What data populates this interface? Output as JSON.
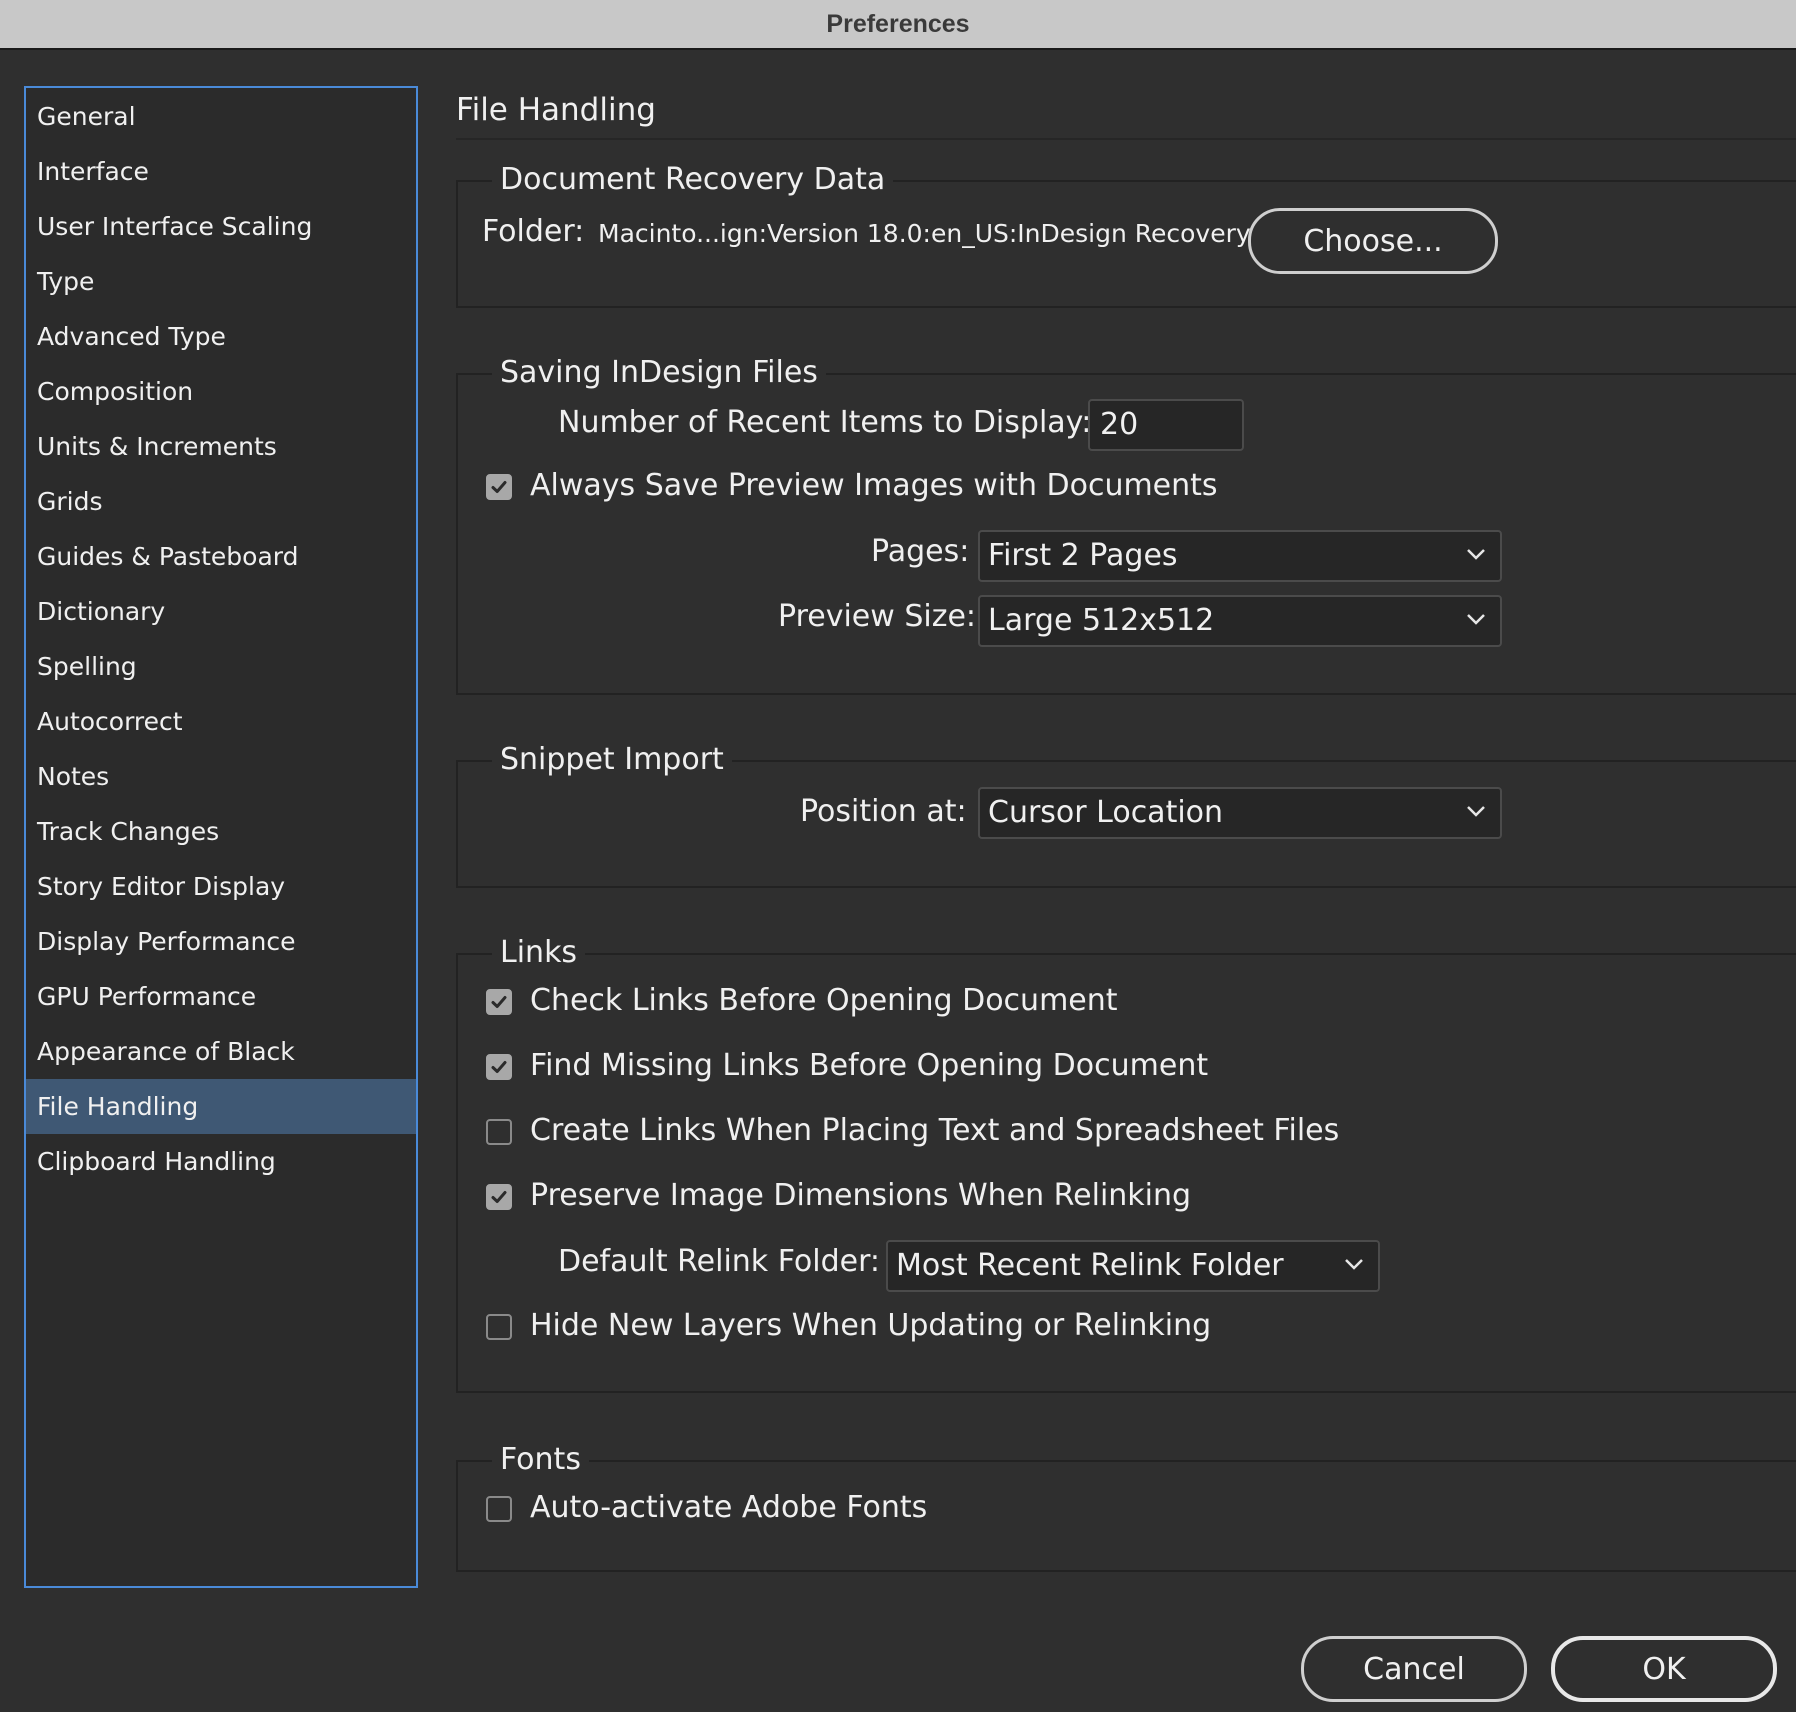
{
  "window": {
    "title": "Preferences"
  },
  "sidebar": {
    "items": [
      {
        "label": "General",
        "selected": false
      },
      {
        "label": "Interface",
        "selected": false
      },
      {
        "label": "User Interface Scaling",
        "selected": false
      },
      {
        "label": "Type",
        "selected": false
      },
      {
        "label": "Advanced Type",
        "selected": false
      },
      {
        "label": "Composition",
        "selected": false
      },
      {
        "label": "Units & Increments",
        "selected": false
      },
      {
        "label": "Grids",
        "selected": false
      },
      {
        "label": "Guides & Pasteboard",
        "selected": false
      },
      {
        "label": "Dictionary",
        "selected": false
      },
      {
        "label": "Spelling",
        "selected": false
      },
      {
        "label": "Autocorrect",
        "selected": false
      },
      {
        "label": "Notes",
        "selected": false
      },
      {
        "label": "Track Changes",
        "selected": false
      },
      {
        "label": "Story Editor Display",
        "selected": false
      },
      {
        "label": "Display Performance",
        "selected": false
      },
      {
        "label": "GPU Performance",
        "selected": false
      },
      {
        "label": "Appearance of Black",
        "selected": false
      },
      {
        "label": "File Handling",
        "selected": true
      },
      {
        "label": "Clipboard Handling",
        "selected": false
      }
    ]
  },
  "main": {
    "title": "File Handling",
    "recovery": {
      "title": "Document Recovery Data",
      "folder_label": "Folder:",
      "folder_path": "Macinto...ign:Version 18.0:en_US:InDesign Recovery",
      "choose_label": "Choose..."
    },
    "saving": {
      "title": "Saving InDesign Files",
      "recent_label": "Number of Recent Items to Display:",
      "recent_value": "20",
      "always_save_label": "Always Save Preview Images with Documents",
      "always_save_checked": true,
      "pages_label": "Pages:",
      "pages_value": "First 2 Pages",
      "preview_size_label": "Preview Size:",
      "preview_size_value": "Large 512x512"
    },
    "snippet": {
      "title": "Snippet Import",
      "position_label": "Position at:",
      "position_value": "Cursor Location"
    },
    "links": {
      "title": "Links",
      "check_links_label": "Check Links Before Opening Document",
      "check_links_checked": true,
      "find_missing_label": "Find Missing Links Before Opening Document",
      "find_missing_checked": true,
      "create_links_label": "Create Links When Placing Text and Spreadsheet Files",
      "create_links_checked": false,
      "preserve_label": "Preserve Image Dimensions When Relinking",
      "preserve_checked": true,
      "relink_folder_label": "Default Relink Folder:",
      "relink_folder_value": "Most Recent Relink Folder",
      "hide_layers_label": "Hide New Layers When Updating or Relinking",
      "hide_layers_checked": false
    },
    "fonts": {
      "title": "Fonts",
      "auto_activate_label": "Auto-activate Adobe Fonts",
      "auto_activate_checked": false
    }
  },
  "footer": {
    "cancel_label": "Cancel",
    "ok_label": "OK"
  },
  "colors": {
    "accent": "#4a8ad8",
    "selected_bg": "#3f5874",
    "window_bg": "#2f2f2f"
  },
  "icons": {
    "checkmark": "checkmark-icon",
    "dropdown": "chevron-down-icon"
  }
}
